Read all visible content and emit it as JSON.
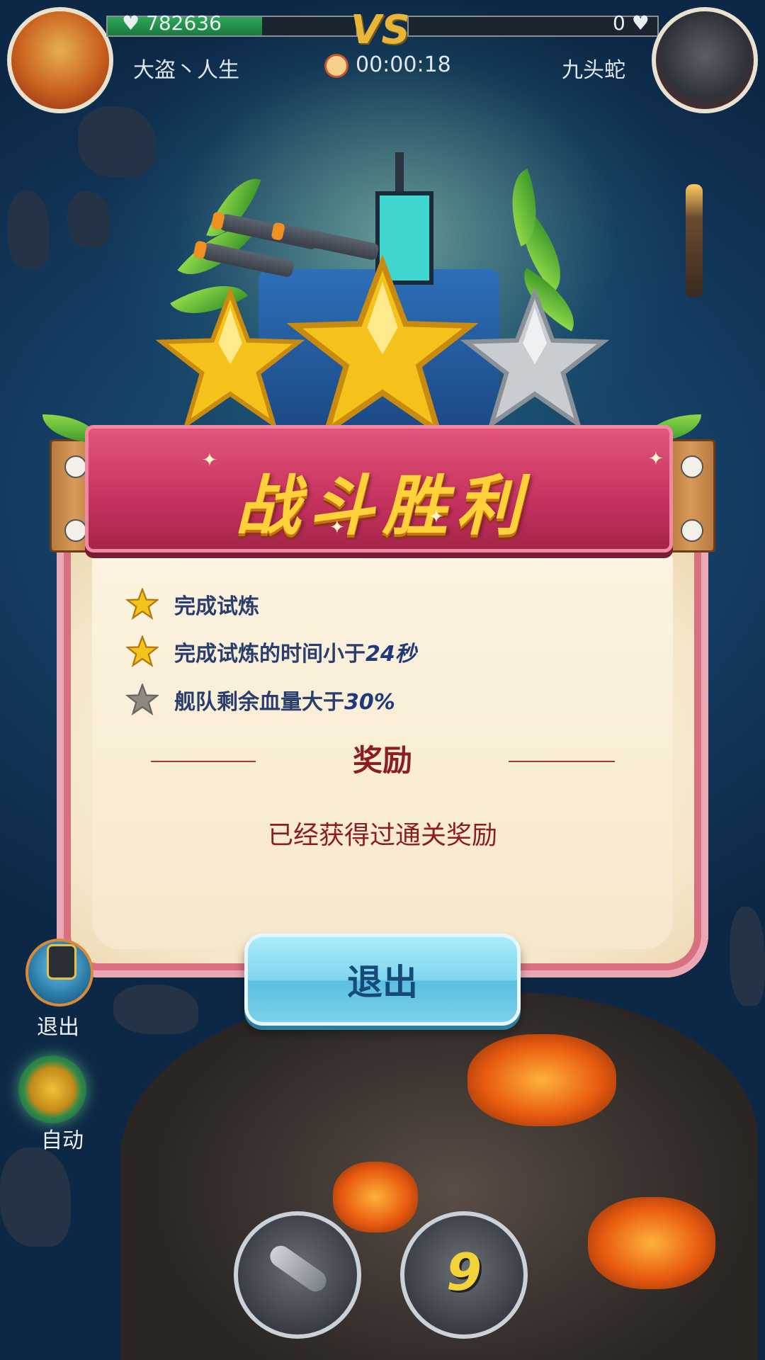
{
  "hud": {
    "player": {
      "name": "大盗丶人生",
      "hp": "782636",
      "avatar": "red-mohawk-pirate"
    },
    "opponent": {
      "name": "九头蛇",
      "hp": "0",
      "avatar": "gas-mask-admiral"
    },
    "vs_label": "VS",
    "timer": "00:00:18",
    "icons": {
      "heart": "heart-icon",
      "clock": "clock-icon"
    }
  },
  "result": {
    "title": "战斗胜利",
    "stars_earned": 2,
    "stars_total": 3
  },
  "requirements": [
    {
      "text": "完成试炼",
      "value": "",
      "achieved": true
    },
    {
      "text": "完成试炼的时间小于",
      "value": "24秒",
      "achieved": true
    },
    {
      "text": "舰队剩余血量大于",
      "value": "30%",
      "achieved": false
    }
  ],
  "reward": {
    "heading": "奖励",
    "message": "已经获得过通关奖励"
  },
  "buttons": {
    "exit_main": "退出",
    "side_exit": "退出",
    "side_auto": "自动"
  },
  "skills": [
    {
      "name": "missile-barrage",
      "count": ""
    },
    {
      "name": "bomb-strike",
      "count": "9"
    }
  ],
  "colors": {
    "banner": "#c6325e",
    "title_gold": "#ffd23a",
    "button": "#7fd6ef",
    "star_gold": "#f5c21c",
    "star_silver": "#c9cdd2"
  }
}
